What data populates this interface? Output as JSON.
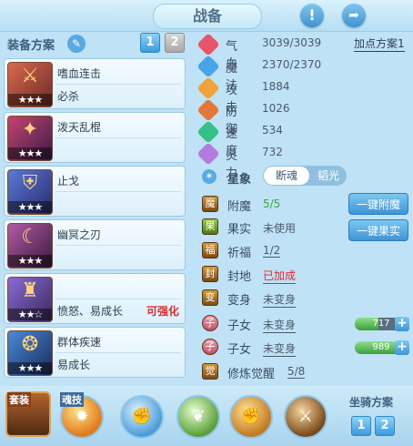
{
  "header": {
    "title": "战备"
  },
  "left": {
    "plan_label": "装备方案",
    "plan_buttons": [
      "1",
      "2"
    ],
    "skills": [
      {
        "name": "嗜血连击",
        "desc": "必杀",
        "tag": "",
        "stars": "★★★",
        "icon": "sword-icon"
      },
      {
        "name": "泼天乱棍",
        "desc": "",
        "tag": "",
        "stars": "★★★",
        "icon": "staff-icon"
      },
      {
        "name": "止戈",
        "desc": "",
        "tag": "",
        "stars": "★★★",
        "icon": "shield-icon"
      },
      {
        "name": "幽冥之刃",
        "desc": "",
        "tag": "",
        "stars": "★★★",
        "icon": "blade-icon"
      },
      {
        "name": "",
        "desc": "愤怒、易成长",
        "tag": "可强化",
        "stars": "★★☆",
        "icon": "chest-icon"
      },
      {
        "name": "群体疾速",
        "desc": "易成长",
        "tag": "",
        "stars": "★★★",
        "icon": "swift-icon"
      }
    ]
  },
  "right": {
    "plan_add": "加点方案1",
    "stats": [
      {
        "label": "气血",
        "value": "3039/3039",
        "color": "#e8556a"
      },
      {
        "label": "魔法",
        "value": "2370/2370",
        "color": "#4aa3e8"
      },
      {
        "label": "攻击",
        "value": "1884",
        "color": "#f2a23a"
      },
      {
        "label": "防御",
        "value": "1026",
        "color": "#e2793a"
      },
      {
        "label": "速度",
        "value": "534",
        "color": "#35c08a"
      },
      {
        "label": "灵力",
        "value": "732",
        "color": "#b57ae0"
      }
    ],
    "aura": {
      "label": "星象",
      "on": "断魂",
      "off": "韬光"
    },
    "features": [
      {
        "label": "附魔",
        "value": "5/5",
        "value_color": "#3aa83a"
      },
      {
        "label": "果实",
        "value": "未使用",
        "value_color": "#4b5a68"
      },
      {
        "label": "祈福",
        "value": "1/2",
        "value_color": "#4b5a68"
      },
      {
        "label": "封地",
        "value": "已加成",
        "value_color": "#e22a2a"
      },
      {
        "label": "变身",
        "value": "未变身",
        "value_color": "#4b5a68"
      },
      {
        "label": "子女",
        "value": "未变身",
        "value_color": "#4b5a68"
      },
      {
        "label": "子女",
        "value": "未变身",
        "value_color": "#4b5a68"
      },
      {
        "label": "修炼觉醒",
        "value": "5/8",
        "value_color": "#4b5a68"
      }
    ],
    "btn_enchant": "一键附魔",
    "btn_fruit": "一键果实",
    "child1_points": "717",
    "child2_points": "989"
  },
  "bottom": {
    "suit_label": "套装",
    "soul_label": "魂技",
    "mount_label": "坐骑方案",
    "mount_buttons": [
      "1",
      "2"
    ]
  }
}
